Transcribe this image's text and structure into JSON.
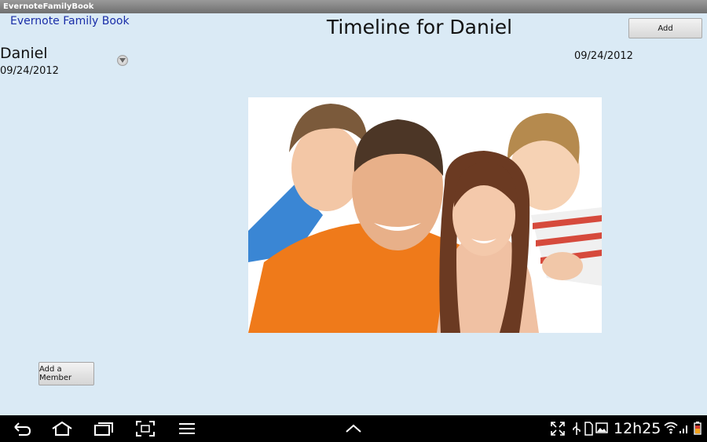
{
  "window": {
    "title": "EvernoteFamilyBook"
  },
  "header": {
    "app_link": "Evernote Family Book",
    "page_title": "Timeline for Daniel",
    "add_label": "Add"
  },
  "member": {
    "name": "Daniel",
    "date": "09/24/2012"
  },
  "timeline": {
    "entry_date": "09/24/2012"
  },
  "footer": {
    "add_member_label": "Add a Member"
  },
  "systembar": {
    "time": "12h25"
  }
}
